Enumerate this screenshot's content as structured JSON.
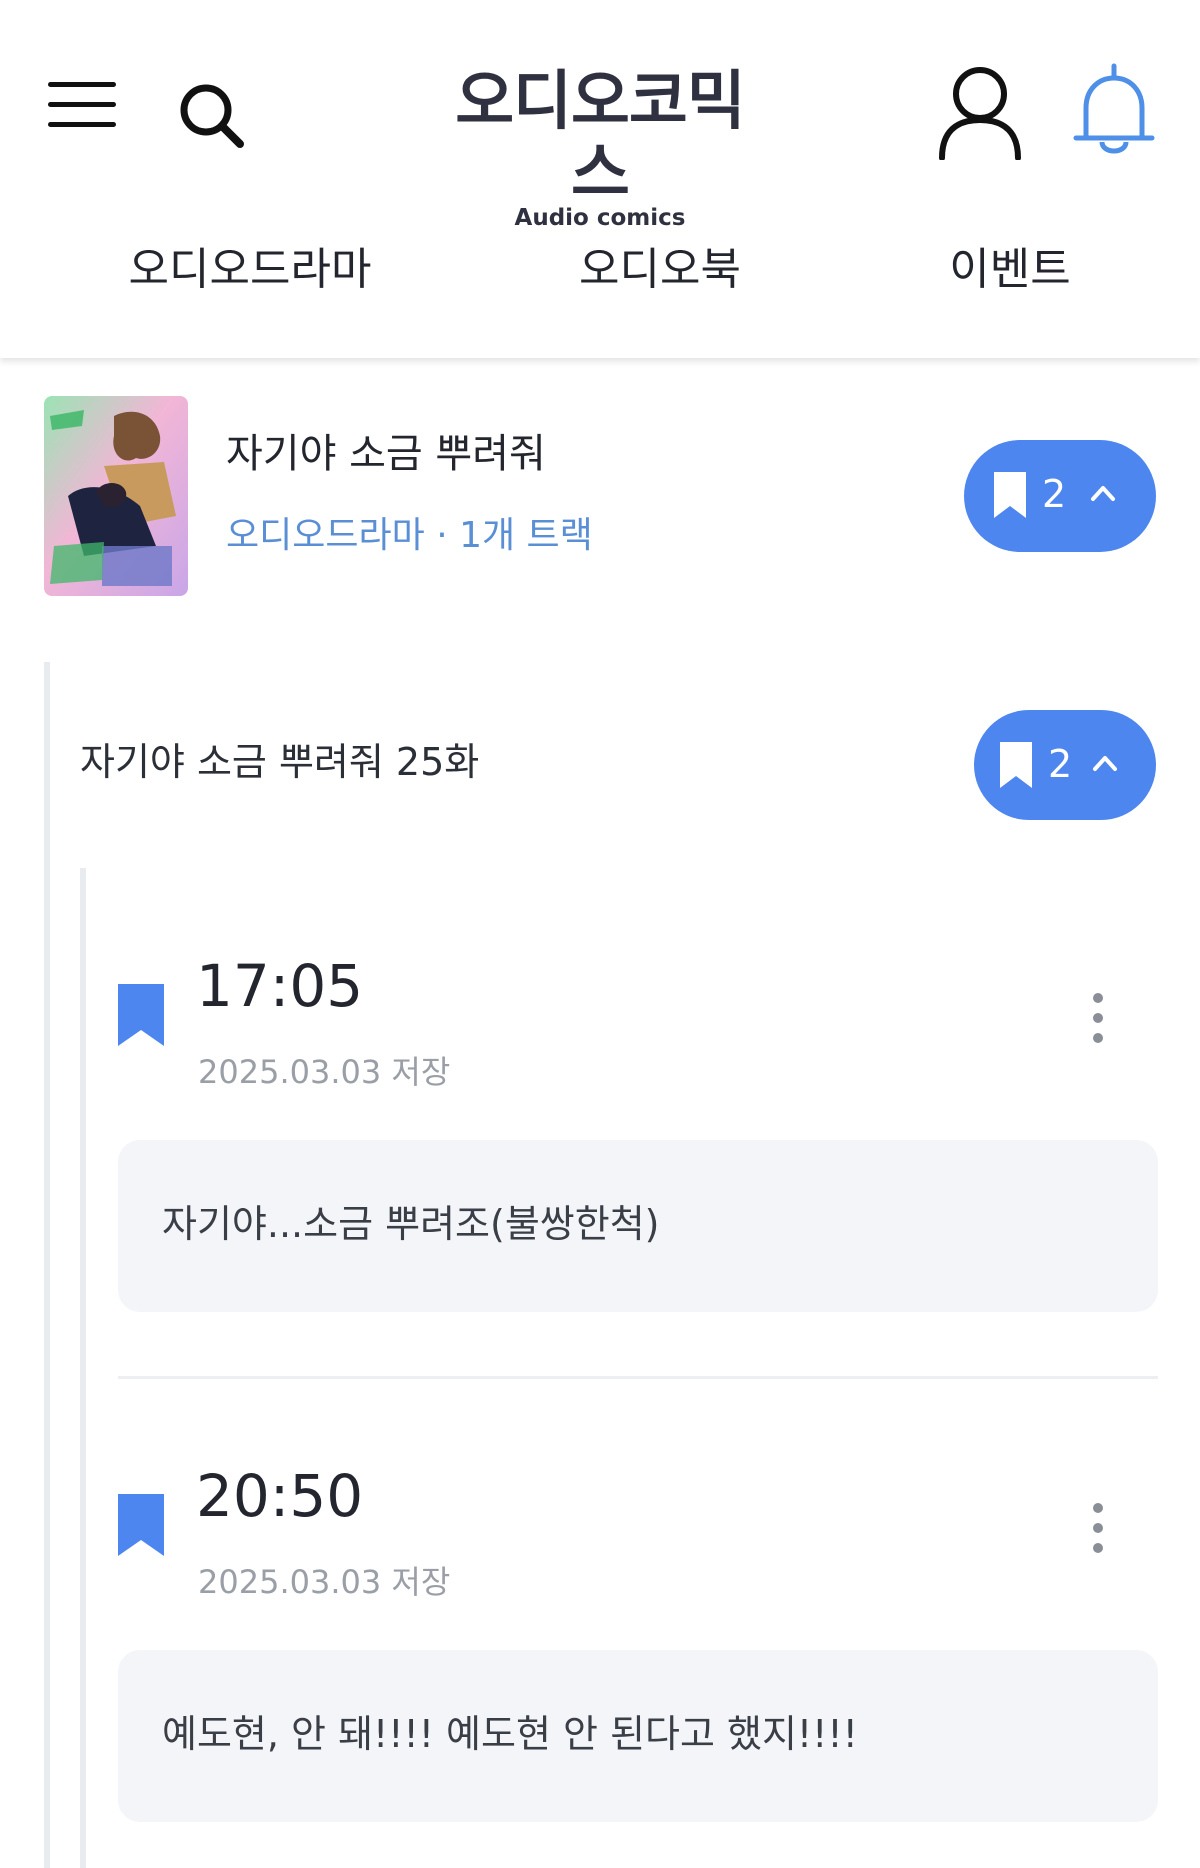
{
  "header": {
    "logo_main": "오디오코믹스",
    "logo_sub": "Audio comics",
    "icons": {
      "menu": "hamburger-menu-icon",
      "search": "search-icon",
      "user": "user-profile-icon",
      "bell": "notification-bell-icon"
    },
    "accent_color": "#4e86f0"
  },
  "nav": {
    "tabs": [
      {
        "label": "오디오드라마"
      },
      {
        "label": "오디오북"
      },
      {
        "label": "이벤트"
      }
    ]
  },
  "series": {
    "title": "자기야 소금 뿌려줘",
    "category": "오디오드라마",
    "separator": "·",
    "track_count": "1개 트랙",
    "bookmark_count": "2"
  },
  "episode": {
    "title": "자기야 소금 뿌려줘 25화",
    "bookmark_count": "2"
  },
  "bookmarks": [
    {
      "time": "17:05",
      "saved": "2025.03.03 저장",
      "note": "자기야...소금 뿌려조(불쌍한척)"
    },
    {
      "time": "20:50",
      "saved": "2025.03.03 저장",
      "note": "예도현, 안 돼!!!! 예도현 안 된다고 했지!!!!"
    }
  ]
}
